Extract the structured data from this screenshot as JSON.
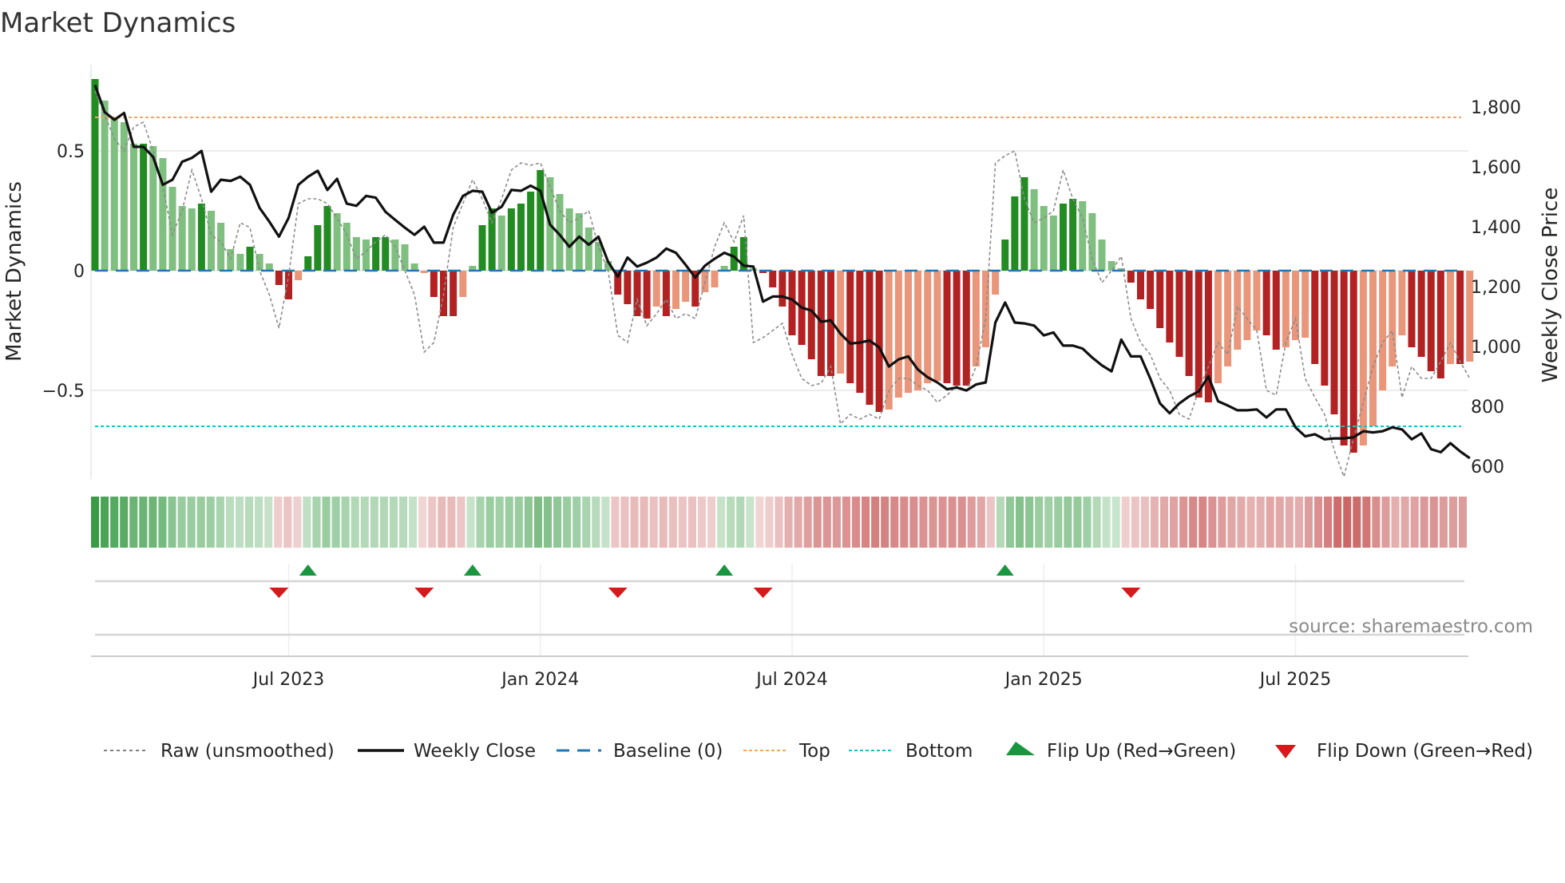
{
  "title": "Market Dynamics",
  "source": "source: sharemaestro.com",
  "legend": {
    "raw": "Raw (unsmoothed)",
    "close": "Weekly Close",
    "baseline": "Baseline (0)",
    "top": "Top",
    "bottom": "Bottom",
    "flip_up": "Flip Up (Red→Green)",
    "flip_down": "Flip Down (Green→Red)"
  },
  "colors": {
    "dark_green": "#228b22",
    "light_green": "#7fbf7f",
    "dark_red": "#b22222",
    "light_red": "#e9967a",
    "top": "#f4a460",
    "bottom": "#17becf",
    "baseline": "#1f77b4",
    "flip_up": "#1a9641",
    "flip_down": "#d7191c"
  },
  "chart_data": {
    "type": "bar",
    "title": "Market Dynamics",
    "ylabel": "Market Dynamics",
    "y2label": "Weekly Close Price",
    "ylim": [
      -0.87,
      0.83
    ],
    "y2lim": [
      560,
      1880
    ],
    "yticks": [
      {
        "v": 0.5,
        "label": "0.5"
      },
      {
        "v": 0,
        "label": "0"
      },
      {
        "v": -0.5,
        "label": "−0.5"
      }
    ],
    "y2ticks": [
      {
        "v": 1800,
        "label": "1,800"
      },
      {
        "v": 1600,
        "label": "1,600"
      },
      {
        "v": 1400,
        "label": "1,400"
      },
      {
        "v": 1200,
        "label": "1,200"
      },
      {
        "v": 1000,
        "label": "1,000"
      },
      {
        "v": 800,
        "label": "800"
      },
      {
        "v": 600,
        "label": "600"
      }
    ],
    "xticks": [
      {
        "week": 20,
        "label": "Jul 2023"
      },
      {
        "week": 46,
        "label": "Jan 2024"
      },
      {
        "week": 72,
        "label": "Jul 2024"
      },
      {
        "week": 98,
        "label": "Jan 2025"
      },
      {
        "week": 124,
        "label": "Jul 2025"
      }
    ],
    "top": 0.64,
    "bottom": -0.65,
    "smoothed": [
      0.8,
      0.71,
      0.64,
      0.62,
      0.53,
      0.53,
      0.52,
      0.47,
      0.35,
      0.27,
      0.26,
      0.28,
      0.25,
      0.2,
      0.09,
      0.07,
      0.1,
      0.07,
      0.03,
      -0.06,
      -0.12,
      -0.04,
      0.06,
      0.19,
      0.27,
      0.24,
      0.2,
      0.14,
      0.13,
      0.14,
      0.14,
      0.13,
      0.11,
      0.03,
      -0.01,
      -0.11,
      -0.19,
      -0.19,
      -0.11,
      0.02,
      0.19,
      0.26,
      0.23,
      0.26,
      0.28,
      0.33,
      0.42,
      0.39,
      0.32,
      0.26,
      0.24,
      0.18,
      0.12,
      0.04,
      -0.1,
      -0.14,
      -0.19,
      -0.2,
      -0.15,
      -0.19,
      -0.16,
      -0.13,
      -0.15,
      -0.09,
      -0.07,
      0.02,
      0.1,
      0.14,
      0.01,
      -0.01,
      -0.07,
      -0.15,
      -0.27,
      -0.31,
      -0.37,
      -0.44,
      -0.44,
      -0.43,
      -0.47,
      -0.51,
      -0.56,
      -0.59,
      -0.58,
      -0.53,
      -0.51,
      -0.5,
      -0.47,
      -0.46,
      -0.47,
      -0.48,
      -0.48,
      -0.4,
      -0.32,
      -0.1,
      0.13,
      0.31,
      0.39,
      0.34,
      0.27,
      0.23,
      0.28,
      0.3,
      0.29,
      0.24,
      0.13,
      0.04,
      0.01,
      -0.05,
      -0.12,
      -0.16,
      -0.24,
      -0.3,
      -0.36,
      -0.44,
      -0.53,
      -0.55,
      -0.47,
      -0.4,
      -0.33,
      -0.29,
      -0.25,
      -0.27,
      -0.33,
      -0.32,
      -0.29,
      -0.28,
      -0.39,
      -0.48,
      -0.6,
      -0.73,
      -0.76,
      -0.73,
      -0.65,
      -0.5,
      -0.4,
      -0.27,
      -0.32,
      -0.36,
      -0.42,
      -0.45,
      -0.39,
      -0.39,
      -0.38
    ],
    "raw": [
      0.75,
      0.65,
      0.55,
      0.5,
      0.6,
      0.62,
      0.5,
      0.35,
      0.15,
      0.25,
      0.42,
      0.3,
      0.15,
      0.12,
      0.05,
      0.2,
      0.18,
      0.0,
      -0.1,
      -0.24,
      -0.02,
      0.28,
      0.3,
      0.3,
      0.28,
      0.22,
      0.15,
      0.05,
      0.08,
      0.12,
      0.15,
      0.1,
      0.0,
      -0.1,
      -0.34,
      -0.3,
      -0.1,
      0.18,
      0.28,
      0.38,
      0.3,
      0.2,
      0.3,
      0.42,
      0.45,
      0.44,
      0.45,
      0.35,
      0.25,
      0.2,
      0.22,
      0.25,
      0.1,
      0.0,
      -0.27,
      -0.3,
      -0.12,
      -0.23,
      -0.18,
      -0.12,
      -0.2,
      -0.18,
      -0.2,
      -0.05,
      0.1,
      0.2,
      0.12,
      0.23,
      -0.3,
      -0.28,
      -0.25,
      -0.22,
      -0.35,
      -0.45,
      -0.48,
      -0.47,
      -0.4,
      -0.64,
      -0.6,
      -0.62,
      -0.6,
      -0.62,
      -0.5,
      -0.45,
      -0.45,
      -0.48,
      -0.5,
      -0.55,
      -0.52,
      -0.48,
      -0.5,
      -0.4,
      -0.2,
      0.45,
      0.48,
      0.5,
      0.3,
      0.2,
      0.22,
      0.25,
      0.42,
      0.3,
      0.22,
      0.05,
      -0.05,
      0.0,
      0.06,
      -0.2,
      -0.3,
      -0.35,
      -0.45,
      -0.5,
      -0.6,
      -0.62,
      -0.5,
      -0.4,
      -0.3,
      -0.35,
      -0.15,
      -0.2,
      -0.25,
      -0.5,
      -0.52,
      -0.3,
      -0.2,
      -0.45,
      -0.53,
      -0.6,
      -0.75,
      -0.86,
      -0.7,
      -0.55,
      -0.4,
      -0.3,
      -0.25,
      -0.53,
      -0.4,
      -0.45,
      -0.45,
      -0.38,
      -0.3,
      -0.38,
      -0.45
    ],
    "close": [
      1873,
      1783,
      1757,
      1780,
      1667,
      1667,
      1633,
      1540,
      1557,
      1617,
      1630,
      1653,
      1517,
      1557,
      1553,
      1567,
      1540,
      1463,
      1417,
      1367,
      1430,
      1540,
      1567,
      1587,
      1523,
      1560,
      1477,
      1470,
      1503,
      1497,
      1450,
      1423,
      1397,
      1373,
      1400,
      1347,
      1347,
      1440,
      1503,
      1520,
      1517,
      1447,
      1467,
      1523,
      1520,
      1537,
      1520,
      1407,
      1373,
      1333,
      1367,
      1340,
      1367,
      1283,
      1233,
      1297,
      1267,
      1280,
      1297,
      1327,
      1313,
      1273,
      1230,
      1270,
      1293,
      1313,
      1300,
      1270,
      1267,
      1150,
      1167,
      1167,
      1157,
      1130,
      1120,
      1083,
      1087,
      1043,
      1010,
      1013,
      1020,
      997,
      933,
      957,
      967,
      923,
      897,
      880,
      857,
      863,
      853,
      873,
      880,
      1080,
      1147,
      1080,
      1077,
      1070,
      1037,
      1047,
      1003,
      1003,
      993,
      963,
      937,
      917,
      1023,
      967,
      967,
      893,
      810,
      777,
      810,
      833,
      850,
      900,
      817,
      803,
      787,
      787,
      790,
      763,
      790,
      790,
      730,
      700,
      707,
      690,
      693,
      693,
      697,
      717,
      713,
      717,
      730,
      723,
      690,
      710,
      657,
      647,
      677,
      650,
      627
    ],
    "flip_up_weeks": [
      22,
      39,
      65,
      94
    ],
    "flip_down_weeks": [
      19,
      34,
      54,
      69,
      107
    ]
  }
}
